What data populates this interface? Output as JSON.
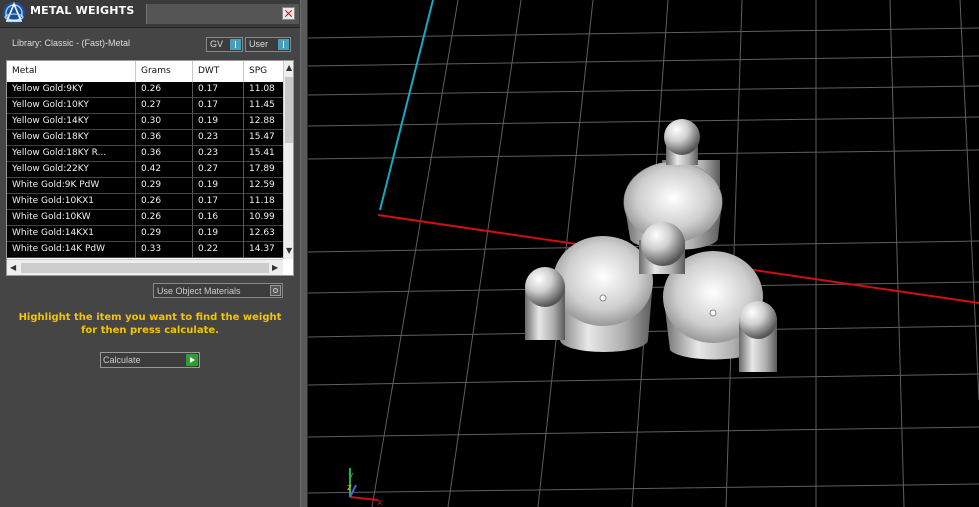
{
  "panel": {
    "title": "METAL WEIGHTS",
    "library": "Library: Classic - (Fast)-Metal",
    "gv_label": "GV",
    "user_label": "User",
    "columns": [
      "Metal",
      "Grams",
      "DWT",
      "SPG"
    ],
    "rows": [
      [
        "Yellow Gold:9KY",
        "0.26",
        "0.17",
        "11.08"
      ],
      [
        "Yellow Gold:10KY",
        "0.27",
        "0.17",
        "11.45"
      ],
      [
        "Yellow Gold:14KY",
        "0.30",
        "0.19",
        "12.88"
      ],
      [
        "Yellow Gold:18KY",
        "0.36",
        "0.23",
        "15.47"
      ],
      [
        "Yellow Gold:18KY R...",
        "0.36",
        "0.23",
        "15.41"
      ],
      [
        "Yellow Gold:22KY",
        "0.42",
        "0.27",
        "17.89"
      ],
      [
        "White Gold:9K PdW",
        "0.29",
        "0.19",
        "12.59"
      ],
      [
        "White Gold:10KX1",
        "0.26",
        "0.17",
        "11.18"
      ],
      [
        "White Gold:10KW",
        "0.26",
        "0.16",
        "10.99"
      ],
      [
        "White Gold:14KX1",
        "0.29",
        "0.19",
        "12.63"
      ],
      [
        "White Gold:14K PdW",
        "0.33",
        "0.22",
        "14.37"
      ]
    ],
    "use_object_materials": "Use Object Materials",
    "instruction": "Highlight the item you want to find the weight for then press calculate.",
    "calculate_label": "Calculate"
  },
  "viewport": {
    "axis_labels": {
      "x": "x",
      "y": "y",
      "z": "z"
    }
  },
  "colors": {
    "panel_bg": "#454545",
    "instruction_text": "#f2c500",
    "x_axis": "#cc1111",
    "y_axis": "#19a9c2",
    "grid": "#666666",
    "calculate_arrow": "#2e9e2e"
  }
}
